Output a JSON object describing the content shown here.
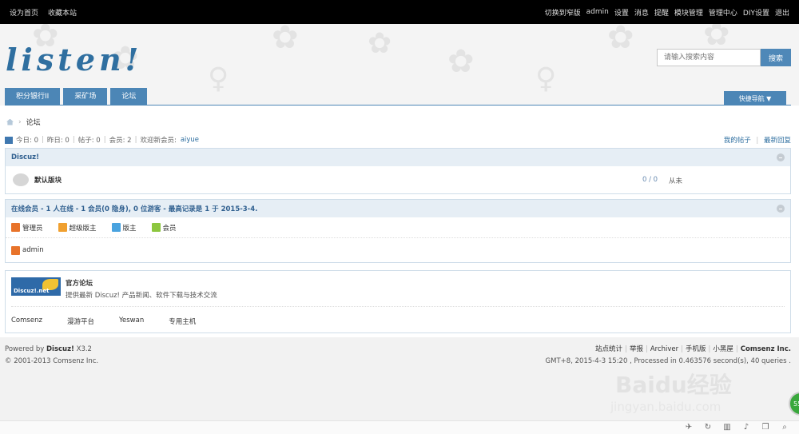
{
  "topbar": {
    "left": [
      "设为首页",
      "收藏本站"
    ],
    "right": [
      "切换到窄版",
      "admin",
      "设置",
      "消息",
      "提醒",
      "模块管理",
      "管理中心",
      "DIY设置",
      "退出"
    ]
  },
  "header": {
    "logo_text": "listen!",
    "search_placeholder": "请输入搜索内容",
    "search_button": "搜索",
    "nav_tabs": [
      "积分银行II",
      "采矿场",
      "论坛"
    ],
    "quick_nav": "快捷导航 ▼"
  },
  "breadcrumb": {
    "current": "论坛"
  },
  "stats": {
    "today": "今日: 0",
    "yesterday": "昨日: 0",
    "posts": "帖子: 0",
    "members": "会员: 2",
    "welcome": "欢迎新会员:",
    "new_member": "aiyue",
    "my_posts": "我的帖子",
    "latest_replies": "最新回复"
  },
  "category": {
    "title": "Discuz!",
    "forum": {
      "name": "默认版块",
      "counts": "0 / 0",
      "last": "从未"
    }
  },
  "online": {
    "title": "在线会员 - 1 人在线 - 1 会员(0 隐身), 0 位游客 - 最高记录是 1 于 2015-3-4.",
    "legend": [
      {
        "label": "管理员",
        "color": "#e8732a"
      },
      {
        "label": "超级版主",
        "color": "#f0a030"
      },
      {
        "label": "版主",
        "color": "#4aa3df"
      },
      {
        "label": "会员",
        "color": "#8cc63f"
      }
    ],
    "users": [
      {
        "name": "admin",
        "color": "#e8732a"
      }
    ]
  },
  "links": {
    "logo_text": "Discuz!.net",
    "official_title": "官方论坛",
    "official_desc": "提供最新 Discuz! 产品新闻、软件下载与技术交流",
    "items": [
      "Comsenz",
      "漫游平台",
      "Yeswan",
      "专用主机"
    ]
  },
  "footer": {
    "powered_prefix": "Powered by",
    "powered_name": "Discuz!",
    "powered_version": "X3.2",
    "copyright": "© 2001-2013 Comsenz Inc.",
    "links": [
      "站点统计",
      "举报",
      "Archiver",
      "手机版",
      "小黑屋"
    ],
    "company": "Comsenz Inc.",
    "time_info": "GMT+8, 2015-4-3 15:20 , Processed in 0.463576 second(s), 40 queries ."
  },
  "watermark": {
    "line1": "Baidu经验",
    "line2": "jingyan.baidu.com"
  },
  "badge": "55"
}
